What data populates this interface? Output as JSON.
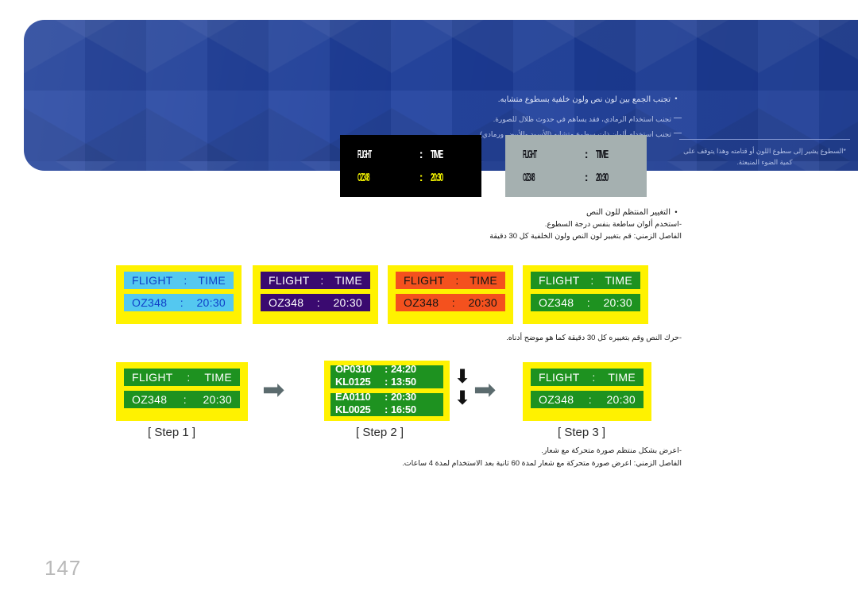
{
  "page": {
    "number": "147",
    "language": "ar",
    "direction": "rtl",
    "background": "#ffffff"
  },
  "banner": {
    "background_color": "#1e3f9e",
    "bullet_glyph": "•",
    "bullet_text": "تجنب الجمع بين لون نص ولون خلفية بسطوع متشابه.",
    "dash_notes": [
      "تجنب استخدام الرمادي، فقد يساهم في حدوث ظلال للصورة.",
      "تجنب استخدام ألوان ذات سطوع متشابه (الأسود والأبيض ورمادي)."
    ],
    "side_note": "*السطوع يشير إلى سطوع اللون أو قتامته وهذا يتوقف على كمية الضوء المنبعثة."
  },
  "lcd_panels": {
    "black": {
      "background": "#000000",
      "rows": [
        {
          "label": "FLIGHT",
          "separator": ":",
          "value": "TIME",
          "color": "#ffffff"
        },
        {
          "label": "OZ348",
          "separator": ":",
          "value": "20:30",
          "color": "#f5f500"
        }
      ]
    },
    "gray": {
      "background": "#a5b0b0",
      "rows": [
        {
          "label": "FLIGHT",
          "separator": ":",
          "value": "TIME",
          "color": "#15161c"
        },
        {
          "label": "OZ348",
          "separator": ":",
          "value": "20:30",
          "color": "#15161c"
        }
      ]
    }
  },
  "note_mid": {
    "bullet_glyph": "•",
    "line1": "التغيير المنتظم للون النص",
    "line2": "-استخدم ألوان ساطعة بنفس درجة السطوع.",
    "line3": "الفاصل الزمني: قم بتغيير لون النص ولون الخلفية كل 30 دقيقة"
  },
  "note_steps": {
    "line1": "-حرك النص وقم بتغييره كل 30 دقيقة كما هو موضح أدناه."
  },
  "note_bottom": {
    "bullet_glyph": "•",
    "line1": "-اعرض بشكل منتظم صورة متحركة مع شعار.",
    "line2": "الفاصل الزمني: اعرض صورة متحركة مع شعار لمدة 60 ثانية بعد الاستخدام لمدة 4 ساعات."
  },
  "signs": [
    {
      "name": "cyan",
      "border_color": "#fff200",
      "panel_color": "#54c8f0",
      "text_color": "#1040c8",
      "rows": [
        {
          "c1": "FLIGHT",
          "c2": ":",
          "c3": "TIME"
        },
        {
          "c1": "OZ348",
          "c2": ":",
          "c3": "20:30"
        }
      ]
    },
    {
      "name": "purple",
      "border_color": "#fff200",
      "panel_color": "#3a0a70",
      "text_color": "#ffffff",
      "rows": [
        {
          "c1": "FLIGHT",
          "c2": ":",
          "c3": "TIME"
        },
        {
          "c1": "OZ348",
          "c2": ":",
          "c3": "20:30"
        }
      ]
    },
    {
      "name": "orange",
      "border_color": "#fff200",
      "panel_color": "#f4511e",
      "text_color": "#141414",
      "rows": [
        {
          "c1": "FLIGHT",
          "c2": ":",
          "c3": "TIME"
        },
        {
          "c1": "OZ348",
          "c2": ":",
          "c3": "20:30"
        }
      ]
    },
    {
      "name": "green",
      "border_color": "#fff200",
      "panel_color": "#1e9220",
      "text_color": "#ffffff",
      "rows": [
        {
          "c1": "FLIGHT",
          "c2": ":",
          "c3": "TIME"
        },
        {
          "c1": "OZ348",
          "c2": ":",
          "c3": "20:30"
        }
      ]
    }
  ],
  "steps": {
    "step1": {
      "label": "[ Step 1 ]",
      "sign": {
        "border_color": "#fff200",
        "panel_color": "#1e9220",
        "text_color": "#ffffff",
        "rows": [
          {
            "c1": "FLIGHT",
            "c2": ":",
            "c3": "TIME"
          },
          {
            "c1": "OZ348",
            "c2": ":",
            "c3": "20:30"
          }
        ]
      }
    },
    "step2": {
      "label": "[ Step 2 ]",
      "border_color": "#fff200",
      "panel_color": "#1e9220",
      "text_color": "#ffffff",
      "list_top": [
        {
          "flight": "OP0310",
          "sep": ":",
          "time": "24:20"
        },
        {
          "flight": "KL0125",
          "sep": ":",
          "time": "13:50"
        }
      ],
      "list_bottom": [
        {
          "flight": "EA0110",
          "sep": ":",
          "time": "20:30"
        },
        {
          "flight": "KL0025",
          "sep": ":",
          "time": "16:50"
        }
      ],
      "scroll_glyph": "⬇"
    },
    "step3": {
      "label": "[ Step 3 ]",
      "sign": {
        "border_color": "#fff200",
        "panel_color": "#1e9220",
        "text_color": "#ffffff",
        "rows": [
          {
            "c1": "FLIGHT",
            "c2": ":",
            "c3": "TIME"
          },
          {
            "c1": "OZ348",
            "c2": ":",
            "c3": "20:30"
          }
        ]
      }
    },
    "arrow_glyph": "➡"
  }
}
